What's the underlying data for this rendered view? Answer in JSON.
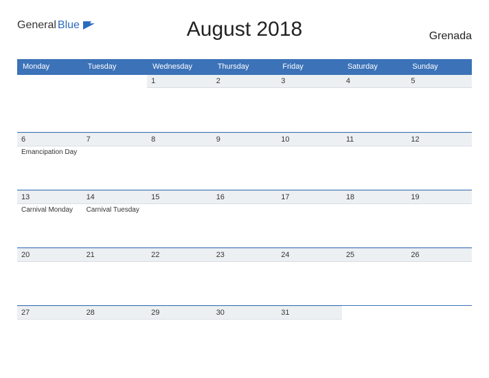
{
  "logo": {
    "part1": "General",
    "part2": "Blue"
  },
  "title": "August 2018",
  "country": "Grenada",
  "weekdays": [
    "Monday",
    "Tuesday",
    "Wednesday",
    "Thursday",
    "Friday",
    "Saturday",
    "Sunday"
  ],
  "weeks": [
    [
      {
        "n": "",
        "events": []
      },
      {
        "n": "",
        "events": []
      },
      {
        "n": "1",
        "events": []
      },
      {
        "n": "2",
        "events": []
      },
      {
        "n": "3",
        "events": []
      },
      {
        "n": "4",
        "events": []
      },
      {
        "n": "5",
        "events": []
      }
    ],
    [
      {
        "n": "6",
        "events": [
          "Emancipation Day"
        ]
      },
      {
        "n": "7",
        "events": []
      },
      {
        "n": "8",
        "events": []
      },
      {
        "n": "9",
        "events": []
      },
      {
        "n": "10",
        "events": []
      },
      {
        "n": "11",
        "events": []
      },
      {
        "n": "12",
        "events": []
      }
    ],
    [
      {
        "n": "13",
        "events": [
          "Carnival Monday"
        ]
      },
      {
        "n": "14",
        "events": [
          "Carnival Tuesday"
        ]
      },
      {
        "n": "15",
        "events": []
      },
      {
        "n": "16",
        "events": []
      },
      {
        "n": "17",
        "events": []
      },
      {
        "n": "18",
        "events": []
      },
      {
        "n": "19",
        "events": []
      }
    ],
    [
      {
        "n": "20",
        "events": []
      },
      {
        "n": "21",
        "events": []
      },
      {
        "n": "22",
        "events": []
      },
      {
        "n": "23",
        "events": []
      },
      {
        "n": "24",
        "events": []
      },
      {
        "n": "25",
        "events": []
      },
      {
        "n": "26",
        "events": []
      }
    ],
    [
      {
        "n": "27",
        "events": []
      },
      {
        "n": "28",
        "events": []
      },
      {
        "n": "29",
        "events": []
      },
      {
        "n": "30",
        "events": []
      },
      {
        "n": "31",
        "events": []
      },
      {
        "n": "",
        "events": []
      },
      {
        "n": "",
        "events": []
      }
    ]
  ]
}
